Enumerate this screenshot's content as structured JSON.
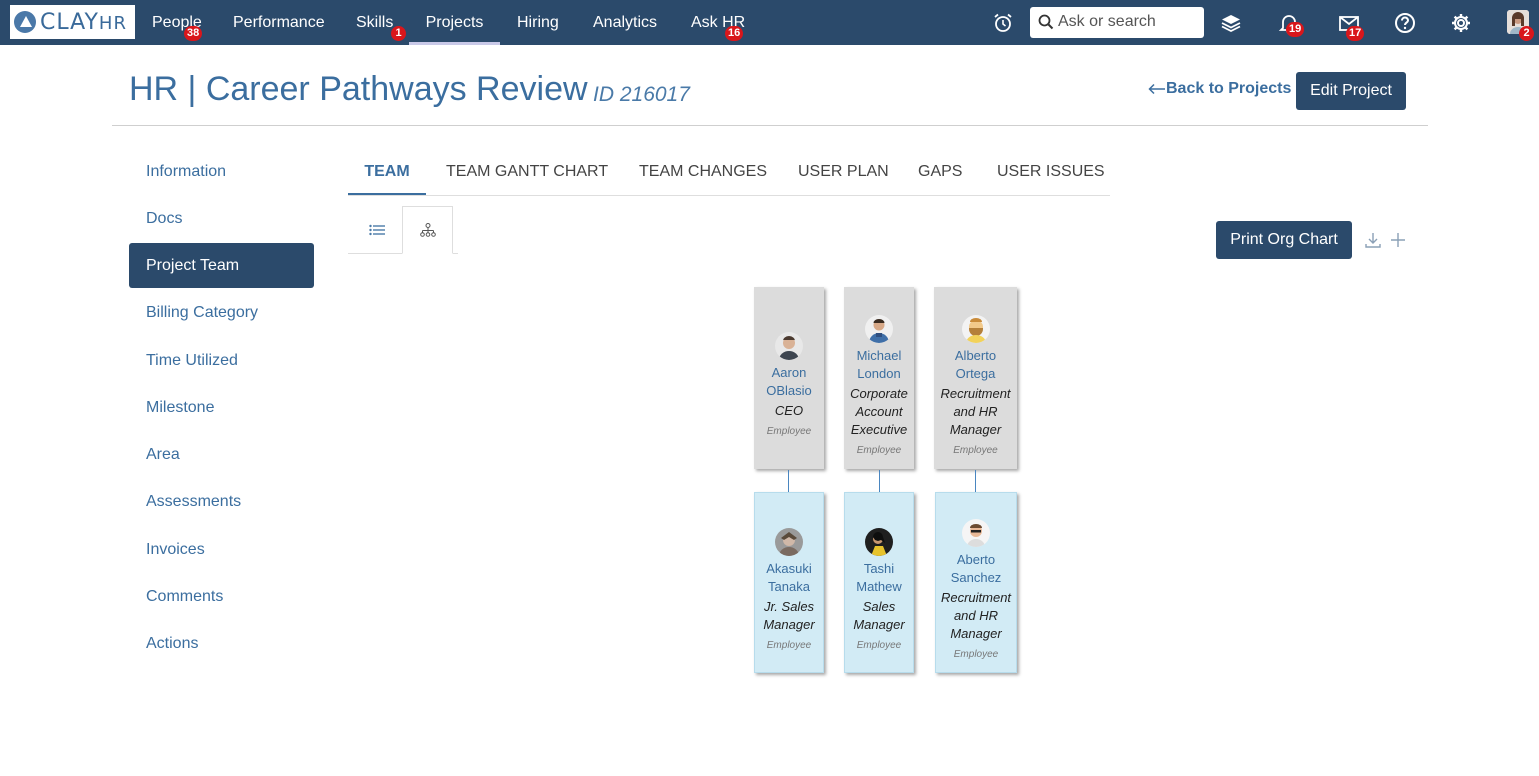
{
  "nav": {
    "logo_main": "CLAY",
    "logo_sub": "HR",
    "items": [
      {
        "label": "People",
        "badge": "38"
      },
      {
        "label": "Performance",
        "badge": ""
      },
      {
        "label": "Skills",
        "badge": "1"
      },
      {
        "label": "Projects",
        "badge": ""
      },
      {
        "label": "Hiring",
        "badge": ""
      },
      {
        "label": "Analytics",
        "badge": ""
      },
      {
        "label": "Ask HR",
        "badge": "16"
      }
    ],
    "search_placeholder": "Ask or search",
    "notifications_badge": "19",
    "messages_badge": "17",
    "avatar_badge": "2"
  },
  "header": {
    "title": "HR | Career Pathways Review",
    "id_label": "ID 216017",
    "back_label": "Back to Projects",
    "edit_label": "Edit Project"
  },
  "sidebar": {
    "items": [
      {
        "label": "Information"
      },
      {
        "label": "Docs"
      },
      {
        "label": "Project Team"
      },
      {
        "label": "Billing Category"
      },
      {
        "label": "Time Utilized"
      },
      {
        "label": "Milestone"
      },
      {
        "label": "Area"
      },
      {
        "label": "Assessments"
      },
      {
        "label": "Invoices"
      },
      {
        "label": "Comments"
      },
      {
        "label": "Actions"
      }
    ]
  },
  "tabs": [
    {
      "label": "TEAM"
    },
    {
      "label": "TEAM GANTT CHART"
    },
    {
      "label": "TEAM CHANGES"
    },
    {
      "label": "USER PLAN"
    },
    {
      "label": "GAPS"
    },
    {
      "label": "USER ISSUES"
    }
  ],
  "print_label": "Print Org Chart",
  "org": {
    "top": [
      {
        "first": "Aaron",
        "last": "OBlasio",
        "role": "CEO",
        "type": "Employee"
      },
      {
        "first": "Michael",
        "last": "London",
        "role": "Corporate Account Executive",
        "type": "Employee"
      },
      {
        "first": "Alberto",
        "last": "Ortega",
        "role": "Recruitment and HR Manager",
        "type": "Employee"
      }
    ],
    "bottom": [
      {
        "first": "Akasuki",
        "last": "Tanaka",
        "role": "Jr. Sales Manager",
        "type": "Employee"
      },
      {
        "first": "Tashi",
        "last": "Mathew",
        "role": "Sales Manager",
        "type": "Employee"
      },
      {
        "first": "Aberto",
        "last": "Sanchez",
        "role": "Recruitment and HR Manager",
        "type": "Employee"
      }
    ]
  },
  "colors": {
    "primary": "#2b4a6b",
    "link": "#3b6e9f",
    "badge": "#d9161b"
  }
}
